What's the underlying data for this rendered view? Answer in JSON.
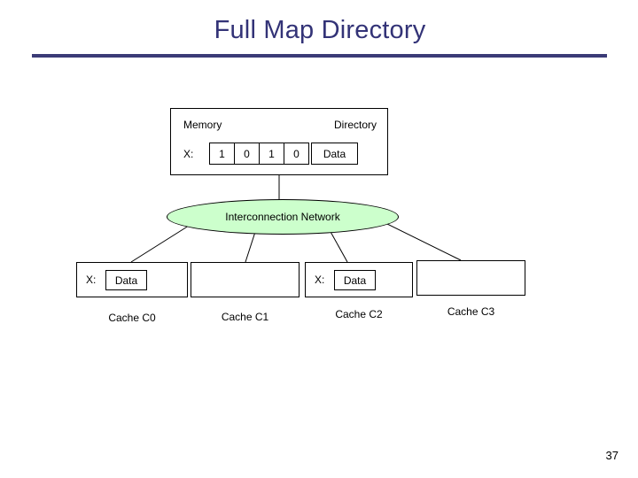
{
  "slide": {
    "title": "Full Map Directory",
    "page_number": "37",
    "title_color": "#333377",
    "rule_color": "#3b3b77",
    "network_fill": "#ccffcc"
  },
  "memory_block": {
    "memory_label": "Memory",
    "directory_label": "Directory",
    "address_label": "X:",
    "presence_bits": [
      "1",
      "0",
      "1",
      "0"
    ],
    "data_label": "Data"
  },
  "network": {
    "label": "Interconnection Network"
  },
  "caches": [
    {
      "caption": "Cache C0",
      "address_label": "X:",
      "data_label": "Data",
      "has_data": true
    },
    {
      "caption": "Cache C1",
      "address_label": "",
      "data_label": "",
      "has_data": false
    },
    {
      "caption": "Cache C2",
      "address_label": "X:",
      "data_label": "Data",
      "has_data": true
    },
    {
      "caption": "Cache C3",
      "address_label": "",
      "data_label": "",
      "has_data": false
    }
  ]
}
